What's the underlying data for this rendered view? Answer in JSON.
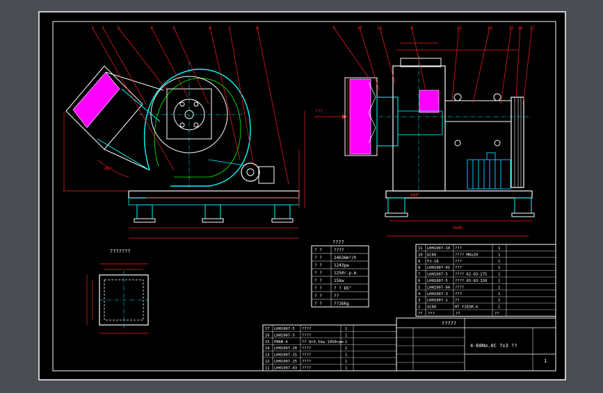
{
  "colors": {
    "canvas": "#000000",
    "app_bg": "#4a4d52",
    "border": "#ffffff",
    "dim": "#ff2020",
    "outline": "#ffffff",
    "part": "#00ffff",
    "inner": "#00ff00",
    "filter": "#ff00ff",
    "motor": "#00c0ff"
  },
  "balloons_left": [
    "1",
    "2",
    "3",
    "4",
    "5",
    "6",
    "7",
    "8"
  ],
  "balloons_right": [
    "9",
    "10",
    "11",
    "8",
    "13",
    "14",
    "15",
    "16",
    "17"
  ],
  "callouts": {
    "left_flow": "???",
    "right_flow": "???",
    "filter_box": "???????",
    "angle": "45°",
    "right_width": "1600",
    "right_width2": "600"
  },
  "params_table": {
    "title": "????",
    "rows": [
      {
        "k1": "?",
        "k2": "?",
        "v": "????"
      },
      {
        "k1": "?",
        "k2": "?",
        "v": "24636m³/h"
      },
      {
        "k1": "?",
        "k2": "?",
        "v": "1243pa"
      },
      {
        "k1": "?",
        "k2": "?",
        "v": "1250r.p.m"
      },
      {
        "k1": "?",
        "k2": "?",
        "v": "15kw"
      },
      {
        "k1": "?",
        "k2": "?",
        "v": "? ? 65°"
      },
      {
        "k1": "?",
        "k2": "?",
        "v": "??"
      },
      {
        "k1": "?",
        "k2": "?",
        "v": "??16kg"
      }
    ]
  },
  "bom_right": {
    "rows": [
      {
        "no": "11",
        "code": "LHH1007-10",
        "name": "???",
        "qty": "1"
      },
      {
        "no": "10",
        "code": "GC60",
        "name": "???? M8x20",
        "qty": "1"
      },
      {
        "no": "9",
        "code": "FJ-18",
        "name": "???",
        "qty": "1"
      },
      {
        "no": "8",
        "code": "LHH1007-01",
        "name": "???",
        "qty": "1"
      },
      {
        "no": "7",
        "code": "LHH1007-5",
        "name": "???? 62-03-275",
        "qty": "1"
      },
      {
        "no": "6",
        "code": "LHH1007-5",
        "name": "???? 65-03-320",
        "qty": "1"
      },
      {
        "no": "5",
        "code": "LHH1007-04",
        "name": "????",
        "qty": "1"
      },
      {
        "no": "4",
        "code": "LHH1007-3",
        "name": "???",
        "qty": "1"
      },
      {
        "no": "3",
        "code": "LHH1007-1",
        "name": "??",
        "qty": "1"
      },
      {
        "no": "2",
        "code": "GC60",
        "name": "HT Y165M-4",
        "qty": "1"
      }
    ],
    "header": [
      "??",
      "???",
      "??",
      "??"
    ]
  },
  "bom_left": {
    "rows": [
      {
        "no": "17",
        "code": "LHH1007-5",
        "name": "????",
        "qty": "1"
      },
      {
        "no": "16",
        "code": "LHH1007-5",
        "name": "????",
        "qty": "1"
      },
      {
        "no": "15",
        "code": "FN6B-4",
        "name": "?? Q=3.5kw 1450rpm",
        "qty": "1"
      },
      {
        "no": "14",
        "code": "LHH1007-20",
        "name": "????",
        "qty": "1"
      },
      {
        "no": "13",
        "code": "LHH1007-15",
        "name": "????",
        "qty": "1"
      },
      {
        "no": "12",
        "code": "LHH1007-25",
        "name": "????",
        "qty": "1"
      },
      {
        "no": "11",
        "code": "LHH1007-03",
        "name": "????",
        "qty": "1"
      }
    ]
  },
  "title_block": {
    "drawing_no": "4-68No.6C 7x3 ??",
    "heading": "?????",
    "sheet": "1"
  }
}
